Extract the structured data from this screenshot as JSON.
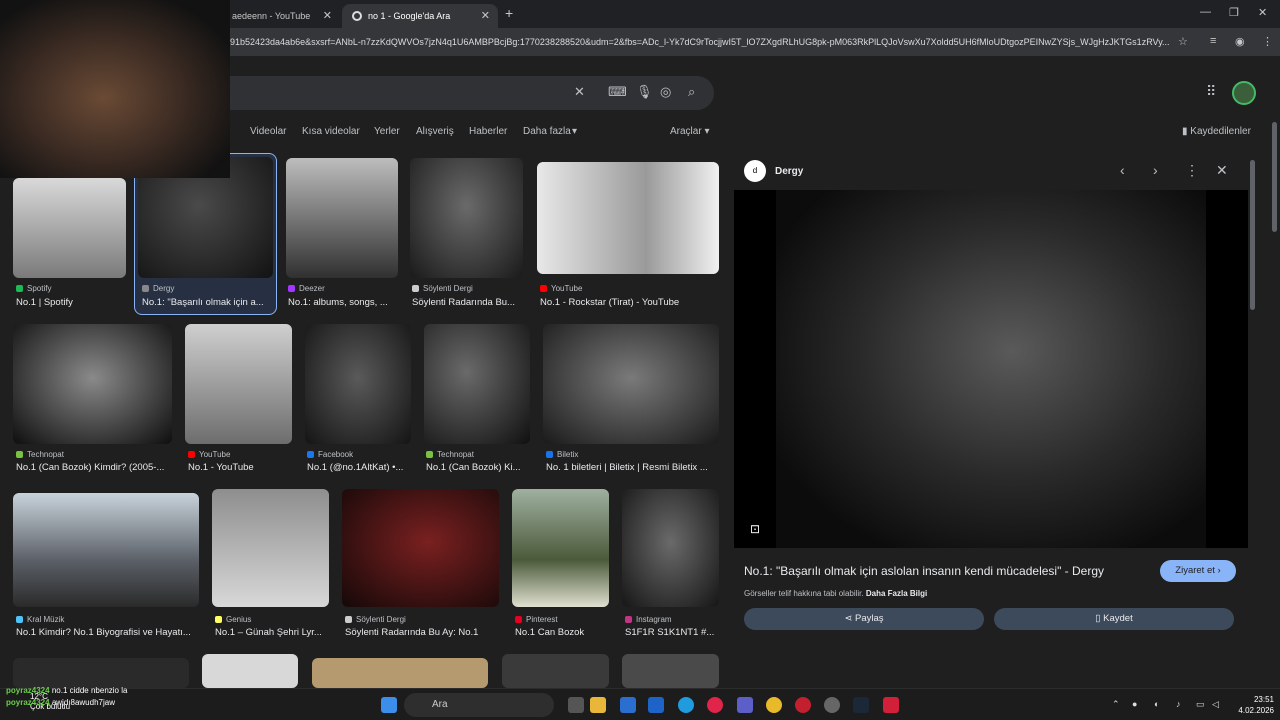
{
  "browser": {
    "tabs": [
      {
        "title": "aedeenn - YouTube"
      },
      {
        "title": "no 1 - Google'da Ara"
      }
    ],
    "new_tab": "+",
    "url": "91b52423da4ab6e&sxsrf=ANbL-n7zzKdQWVOs7jzN4q1U6AMBPBcjBg:1770238288520&udm=2&fbs=ADc_l-Yk7dC9rTocjjwI5T_lO7ZXgdRLhUG8pk-pM063RkPlLQJoVswXu7Xoldd5UH6fMloUDtgozPEINwZYSjs_WJgHzJKTGs1zRVy..."
  },
  "filters": [
    "Videolar",
    "Kısa videolar",
    "Yerler",
    "Alışveriş",
    "Haberler",
    "Daha fazla"
  ],
  "filter_partial": "r",
  "tools_label": "Araçlar",
  "saved_label": "Kaydedilenler",
  "results": [
    {
      "source": "Spotify",
      "caption": "No.1 | Spotify",
      "color": "#1db954"
    },
    {
      "source": "Dergy",
      "caption": "No.1: \"Başarılı olmak için a...",
      "color": "#888888"
    },
    {
      "source": "Deezer",
      "caption": "No.1: albums, songs, ...",
      "color": "#a238ff"
    },
    {
      "source": "Söylenti Dergi",
      "caption": "Söylenti Radarında Bu...",
      "color": "#cccccc"
    },
    {
      "source": "YouTube",
      "caption": "No.1 - Rockstar (Tirat) - YouTube",
      "color": "#ff0000"
    },
    {
      "source": "Technopat",
      "caption": "No.1 (Can Bozok) Kimdir? (2005-...",
      "color": "#7ac142"
    },
    {
      "source": "YouTube",
      "caption": "No.1 - YouTube",
      "color": "#ff0000"
    },
    {
      "source": "Facebook",
      "caption": "No.1 (@no.1AltKat) •...",
      "color": "#1877f2"
    },
    {
      "source": "Technopat",
      "caption": "No.1 (Can Bozok) Ki...",
      "color": "#7ac142"
    },
    {
      "source": "Biletix",
      "caption": "No. 1 biletleri | Biletix | Resmi Biletix ...",
      "color": "#1a73e8"
    },
    {
      "source": "Kral Müzik",
      "caption": "No.1 Kimdir? No.1 Biyografisi ve Hayatı...",
      "color": "#4fc3f7"
    },
    {
      "source": "Genius",
      "caption": "No.1 – Günah Şehri Lyr...",
      "color": "#ffff64"
    },
    {
      "source": "Söylenti Dergi",
      "caption": "Söylenti Radarında Bu Ay: No.1",
      "color": "#cccccc"
    },
    {
      "source": "Pinterest",
      "caption": "No.1 Can Bozok",
      "color": "#e60023"
    },
    {
      "source": "Instagram",
      "caption": "S1F1R S1K1NT1 #...",
      "color": "#c13584"
    }
  ],
  "panel": {
    "logo": "d",
    "site": "Dergy",
    "caption": "No.1: \"Başarılı olmak için aslolan insanın kendi mücadelesi\" - Dergy",
    "visit": "Ziyaret et",
    "rights": "Görseller telif hakkına tabi olabilir.",
    "more_info": "Daha Fazla Bilgi",
    "share": "Paylaş",
    "save": "Kaydet"
  },
  "chat": [
    {
      "user": "poyraz4324",
      "text": "no.1 cidde nbenzio la"
    },
    {
      "user": "poyraz4324",
      "text": "awjdı8awudh7jaw"
    }
  ],
  "weather": {
    "temp": "12°C",
    "desc": "Çok bulutlu"
  },
  "taskbar": {
    "search": "Ara",
    "time": "23:51",
    "date": "4.02.2026"
  }
}
